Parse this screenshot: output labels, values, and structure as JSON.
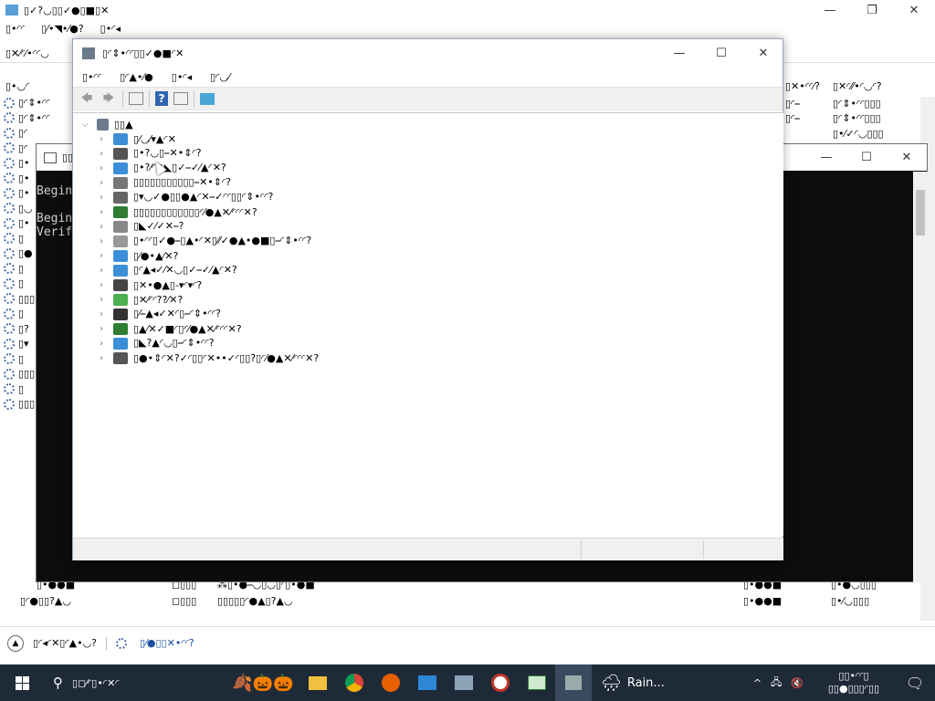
{
  "services": {
    "title": "▯✓?◡▯▯✓●▯■▯✕",
    "menu": [
      "▯•◜◜",
      "▯⁄•◥•⁄●?",
      "▯•◜◂"
    ],
    "toolbar_label": "▯✕⁄◜⁄•◜◜◡",
    "col1_header": "▯•◡◜",
    "col_right_headers": [
      "▯✕•◜◜⁄?",
      "▯✕◜⁄⁄•◜◡◜?"
    ],
    "left_col_items": [
      "▯◜⇕•◜◜",
      "▯◜⇕•◜◜",
      "▯◜",
      "▯◜",
      "▯•",
      "▯•",
      "▯•",
      "▯◡",
      "▯•",
      "▯",
      "▯●",
      "▯",
      "▯",
      "▯▯▯",
      "▯",
      "▯?",
      "▯▾",
      "▯",
      "▯▯▯",
      "▯",
      "▯▯▯"
    ],
    "right_col_a": [
      "▯◜⎯",
      "▯◜⇕•◜◜▯▯▯",
      "▯◜⇕•◜◜▯▯▯",
      "▯•⁄✓◜◡▯▯▯"
    ],
    "bottom_row1": [
      "▯•●●■",
      "◻▯▯▯",
      "⁂▯•●⎯◡▯◡▯◜▯•●■",
      "▯•●●■",
      "▯•●◡▯▯▯"
    ],
    "bottom_row2": [
      "▯◜●▯▯?▲◡",
      "◻▯▯▯",
      "▯▯▯▯▯◜●▲▯?▲◡",
      "▯•●●■",
      "▯•⁄◡▯▯▯"
    ],
    "footer": {
      "fewer_details": "▯◜◂◜✕▯◜▲•◡?",
      "open_services": "▯⁄●▯▯✕•◜◜?"
    }
  },
  "console": {
    "title": "▯▯",
    "lines": [
      "Begin",
      "Begin",
      "Verif"
    ]
  },
  "device_manager": {
    "title": "▯◜⇕•◜◜▯▯✓●■◜✕",
    "menu": [
      "▯•◜◜",
      "▯◜▲•⁄●",
      "▯•◜◂",
      "▯◜◡⁄"
    ],
    "root": "▯▯▲",
    "items": [
      {
        "label": "▯⁄◡⁄▾▲◜✕",
        "icon_color": "#3c8fd6"
      },
      {
        "label": "▯•?◡▯⎯✕•⇕◜?",
        "icon_color": "#555555"
      },
      {
        "label": "▯•?⁄◜✓◣▯✓⎯✓⁄▲◜✕?",
        "icon_color": "#3c8fd6"
      },
      {
        "label": "▯▯▯▯▯▯▯▯▯▯▯⎯✕•⇕◜?",
        "icon_color": "#777777"
      },
      {
        "label": "▯▾◡✓●▯▯●▲◜✕⎯✓◜◜▯▯◜⇕•◜◜?",
        "icon_color": "#666666"
      },
      {
        "label": "▯▯▯▯▯▯▯▯▯▯▯▯◜⁄●▲✕⁄◜◜◜✕?",
        "icon_color": "#2e7d32"
      },
      {
        "label": "▯◣✓⁄✓✕⎯?",
        "icon_color": "#888888"
      },
      {
        "label": "▯•◜◜▯✓●⎯▯▲•◜✕▯⁄⁄✓●▲•●■▯⎯◜⇕•◜◜?",
        "icon_color": "#999999"
      },
      {
        "label": "▯⁄●•▲⁄✕?",
        "icon_color": "#3c8fd6"
      },
      {
        "label": "▯◜▲◂✓⁄✕◡▯✓⎯✓⁄▲◜✕?",
        "icon_color": "#3c8fd6"
      },
      {
        "label": "▯✕•●▲▯-▾◜▾◜?",
        "icon_color": "#444444"
      },
      {
        "label": "▯✕⁄◜◜??⁄✕?",
        "icon_color": "#4caf50"
      },
      {
        "label": "▯⁄⎯▲◂✓✕◜▯⎯◜⇕•◜◜?",
        "icon_color": "#333333"
      },
      {
        "label": "▯▲⁄✕✓■◜▯◜⁄●▲✕⁄◜◜◜✕?",
        "icon_color": "#2e7d32"
      },
      {
        "label": "▯◣?▲◜◡▯⎯◜⇕•◜◜?",
        "icon_color": "#3c8fd6"
      },
      {
        "label": "▯●•⇕◜✕?✓◜▯▯◜✕••✓◜▯▯?▯◜⁄●▲✕⁄◜◜◜✕?",
        "icon_color": "#555555"
      }
    ]
  },
  "taskbar": {
    "search_text": "▯◻⁄◜▯•◜✕◜",
    "weather": "Rain...",
    "tray_time": "▯▯•◜◜▯",
    "tray_date": "▯▯●▯▯▯◜▯▯"
  }
}
